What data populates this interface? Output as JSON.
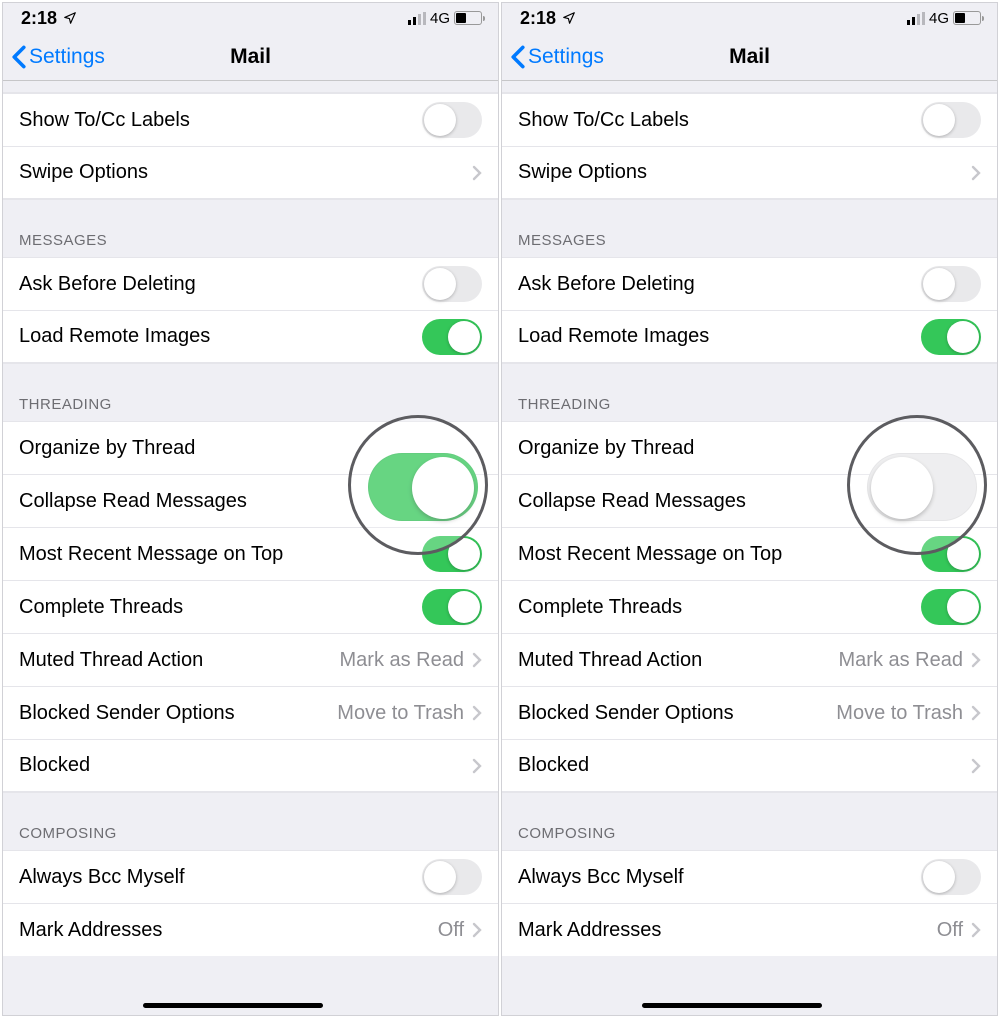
{
  "statusBar": {
    "time": "2:18",
    "network": "4G"
  },
  "nav": {
    "back": "Settings",
    "title": "Mail"
  },
  "sections": {
    "top": {
      "showToCc": "Show To/Cc Labels",
      "swipeOptions": "Swipe Options"
    },
    "messages": {
      "header": "MESSAGES",
      "askBefore": "Ask Before Deleting",
      "loadRemote": "Load Remote Images"
    },
    "threading": {
      "header": "THREADING",
      "organize": "Organize by Thread",
      "collapse": "Collapse Read Messages",
      "mostRecent": "Most Recent Message on Top",
      "complete": "Complete Threads",
      "mutedAction": "Muted Thread Action",
      "mutedActionValue": "Mark as Read",
      "blockedSender": "Blocked Sender Options",
      "blockedSenderValue": "Move to Trash",
      "blocked": "Blocked"
    },
    "composing": {
      "header": "COMPOSING",
      "alwaysBcc": "Always Bcc Myself",
      "markAddresses": "Mark Addresses",
      "markAddressesValue": "Off"
    }
  },
  "panes": {
    "left": {
      "organizeByThreadOn": true
    },
    "right": {
      "organizeByThreadOn": false
    }
  }
}
